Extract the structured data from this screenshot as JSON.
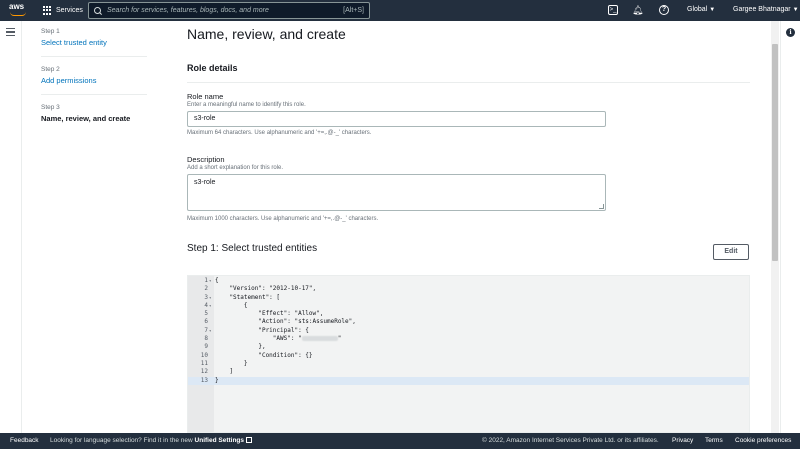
{
  "topnav": {
    "logo": "aws",
    "services": "Services",
    "search_placeholder": "Search for services, features, blogs, docs, and more",
    "search_shortcut": "[Alt+S]",
    "region": "Global",
    "user": "Gargee Bhatnagar"
  },
  "steps": [
    {
      "label": "Step 1",
      "name": "Select trusted entity"
    },
    {
      "label": "Step 2",
      "name": "Add permissions"
    },
    {
      "label": "Step 3",
      "name": "Name, review, and create"
    }
  ],
  "main": {
    "page_title": "Name, review, and create",
    "panel_title": "Role details",
    "role_name": {
      "label": "Role name",
      "description": "Enter a meaningful name to identify this role.",
      "value": "s3-role",
      "constraint": "Maximum 64 characters. Use alphanumeric and '+=,.@-_' characters."
    },
    "description": {
      "label": "Description",
      "description": "Add a short explanation for this role.",
      "value": "s3-role",
      "constraint": "Maximum 1000 characters. Use alphanumeric and '+=,.@-_' characters."
    },
    "trusted_section_title": "Step 1: Select trusted entities",
    "edit_label": "Edit"
  },
  "policy_lines": [
    {
      "n": "1",
      "fold": true,
      "text": "{"
    },
    {
      "n": "2",
      "fold": false,
      "text": "    \"Version\": \"2012-10-17\","
    },
    {
      "n": "3",
      "fold": true,
      "text": "    \"Statement\": ["
    },
    {
      "n": "4",
      "fold": true,
      "text": "        {"
    },
    {
      "n": "5",
      "fold": false,
      "text": "            \"Effect\": \"Allow\","
    },
    {
      "n": "6",
      "fold": false,
      "text": "            \"Action\": \"sts:AssumeRole\","
    },
    {
      "n": "7",
      "fold": true,
      "text": "            \"Principal\": {"
    },
    {
      "n": "8",
      "fold": false,
      "text": "                \"AWS\": \"",
      "redacted": true,
      "tail": "\""
    },
    {
      "n": "9",
      "fold": false,
      "text": "            },"
    },
    {
      "n": "10",
      "fold": false,
      "text": "            \"Condition\": {}"
    },
    {
      "n": "11",
      "fold": false,
      "text": "        }"
    },
    {
      "n": "12",
      "fold": false,
      "text": "    ]"
    },
    {
      "n": "13",
      "fold": false,
      "text": "}",
      "active": true
    }
  ],
  "footer": {
    "feedback": "Feedback",
    "language_prompt": "Looking for language selection? Find it in the new",
    "unified_settings": "Unified Settings",
    "copyright": "© 2022, Amazon Internet Services Private Ltd. or its affiliates.",
    "privacy": "Privacy",
    "terms": "Terms",
    "cookie": "Cookie preferences"
  }
}
